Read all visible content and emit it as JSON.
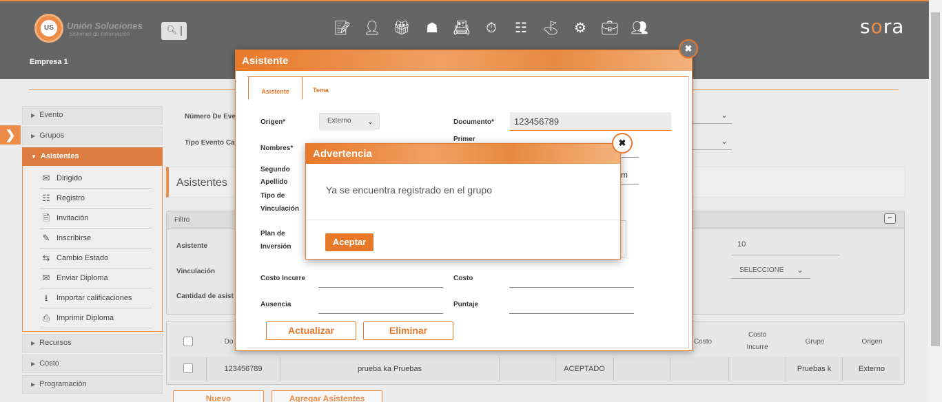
{
  "header": {
    "logo_badge": "US",
    "logo_title": "Unión Soluciones",
    "logo_subtitle": "Sistemas de Información",
    "search_icon": "search-icon",
    "company": "Empresa 1",
    "brand_prefix": "s",
    "brand_mid": "o",
    "brand_suffix": "ra",
    "nav_icons": [
      "document-edit-icon",
      "person-icon",
      "gift-icon",
      "org-chart-icon",
      "person-card-icon",
      "stopwatch-icon",
      "report-icon",
      "presenter-icon",
      "gears-icon",
      "briefcase-location-icon",
      "person-badge-icon"
    ]
  },
  "sidebar": {
    "toggle_icon": "chevron-right-icon",
    "items": [
      {
        "label": "Evento"
      },
      {
        "label": "Grupos"
      },
      {
        "label": "Asistentes"
      }
    ],
    "submenu": [
      {
        "label": "Dirigido",
        "icon": "mail-icon"
      },
      {
        "label": "Registro",
        "icon": "form-icon"
      },
      {
        "label": "Invitación",
        "icon": "file-icon"
      },
      {
        "label": "Inscribirse",
        "icon": "pen-icon"
      },
      {
        "label": "Cambio Estado",
        "icon": "swap-icon"
      },
      {
        "label": "Enviar Diploma",
        "icon": "envelope-open-icon"
      },
      {
        "label": "Importar calificaciones",
        "icon": "import-icon"
      },
      {
        "label": "Imprimir Diploma",
        "icon": "printer-icon"
      }
    ],
    "items_after": [
      {
        "label": "Recursos"
      },
      {
        "label": "Costo"
      },
      {
        "label": "Programación"
      }
    ]
  },
  "background": {
    "numero_evento_label": "Número De Eve",
    "tipo_evento_label": "Tipo Evento Ca",
    "pane_title": "Asistentes",
    "filter_title": "Filtro",
    "filter_asistente": "Asistente",
    "filter_vinculacion": "Vinculación",
    "filter_cantidad": "Cantidad de asist",
    "filter_value_10": "10",
    "filter_select": "SELECCIONE",
    "table_headers": {
      "doc": "Do",
      "costo": "Costo",
      "costo_incurre_1": "Costo",
      "costo_incurre_2": "Incurre",
      "grupo": "Grupo",
      "origen": "Origen"
    },
    "row": {
      "documento": "123456789",
      "nombre": "prueba ka Pruebas",
      "estado": "ACEPTADO",
      "grupo": "Pruebas k",
      "origen": "Externo"
    },
    "btn_nuevo": "Nuevo",
    "btn_agregar": "Agregar Asistentes"
  },
  "modal": {
    "title": "Asistente",
    "tabs": [
      "Asistente",
      "Tema"
    ],
    "fields": {
      "origen_label": "Origen*",
      "origen_value": "Externo",
      "documento_label": "Documento*",
      "documento_value": "123456789",
      "nombres_label": "Nombres*",
      "primer_label": "Primer",
      "segundo_label": "Segundo",
      "apellido_label": "Apellido",
      "partial_m": "m",
      "tipo_label": "Tipo de",
      "vinculacion_label": "Vinculación",
      "plan_label": "Plan de",
      "inversion_label": "Inversión",
      "costo_incurre_label": "Costo Incurre",
      "costo_label": "Costo",
      "ausencia_label": "Ausencia",
      "puntaje_label": "Puntaje"
    },
    "btn_actualizar": "Actualizar",
    "btn_eliminar": "Eliminar"
  },
  "warning": {
    "title": "Advertencia",
    "message": "Ya se encuentra registrado en el grupo",
    "btn_ok": "Aceptar"
  },
  "colors": {
    "accent": "#e8792a",
    "header_bg": "#4a4a4a"
  }
}
